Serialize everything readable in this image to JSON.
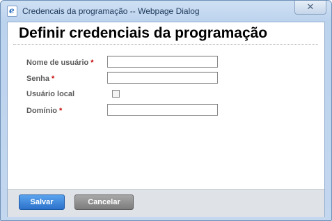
{
  "window": {
    "title": "Credencais da programação -- Webpage Dialog",
    "close_symbol": "✕",
    "app_icon": "ie-icon"
  },
  "page": {
    "title": "Definir credenciais da programação"
  },
  "form": {
    "required_marker": "*",
    "username": {
      "label": "Nome de usuário",
      "value": ""
    },
    "password": {
      "label": "Senha",
      "value": ""
    },
    "local_user": {
      "label": "Usuário local",
      "checked": false
    },
    "domain": {
      "label": "Domínio",
      "value": ""
    }
  },
  "footer": {
    "save_label": "Salvar",
    "cancel_label": "Cancelar"
  },
  "colors": {
    "save_button": "#2c72cb",
    "cancel_button": "#7c7c7c",
    "required_marker": "#c40000",
    "frame": "#c3d7ef"
  }
}
